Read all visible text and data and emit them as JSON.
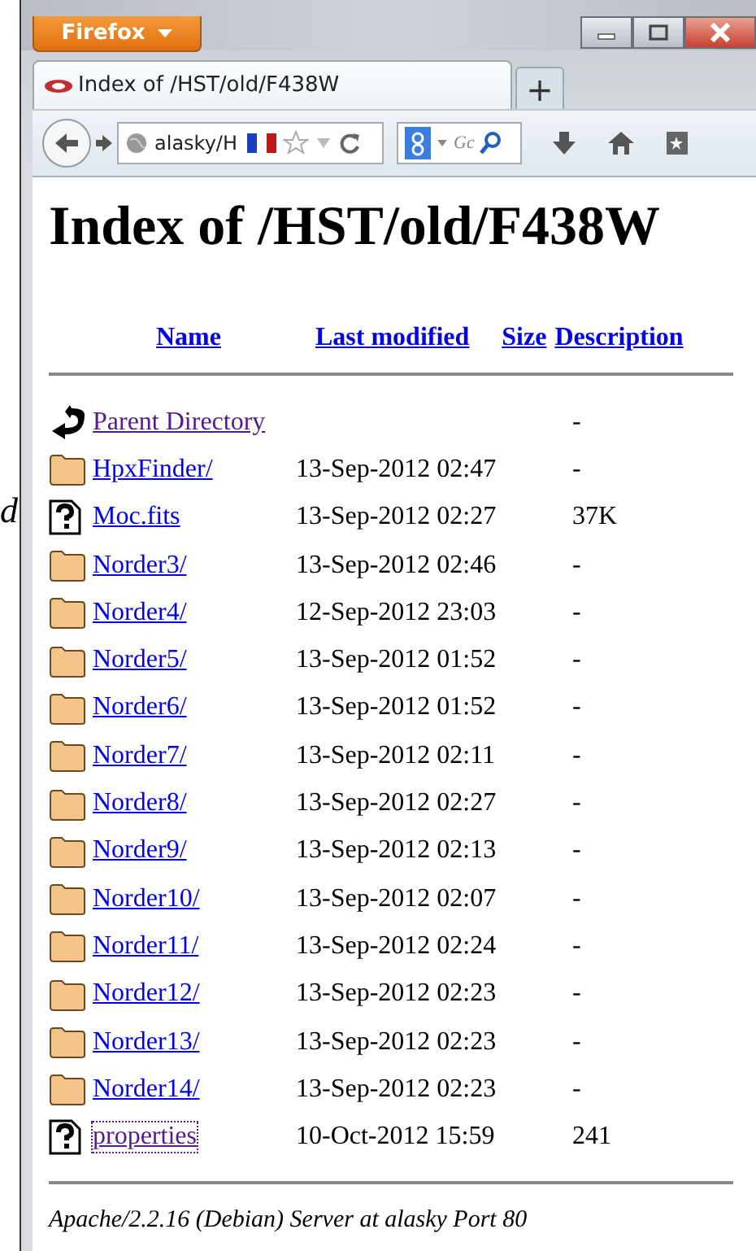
{
  "background_text": "d",
  "browser": {
    "menu_button": "Firefox",
    "tab": {
      "title": "Index of /HST/old/F438W",
      "selected": true
    },
    "new_tab": "+",
    "address": "alasky/H",
    "search_placeholder": "Gc"
  },
  "page": {
    "heading": "Index of /HST/old/F438W",
    "columns": [
      "Name",
      "Last modified",
      "Size",
      "Description"
    ],
    "rows": [
      {
        "kind": "parent",
        "name": "Parent Directory",
        "modified": "",
        "size": "-",
        "visited": true,
        "focused": false
      },
      {
        "kind": "folder",
        "name": "HpxFinder/",
        "modified": "13-Sep-2012 02:47",
        "size": "-",
        "visited": false,
        "focused": false
      },
      {
        "kind": "file",
        "name": "Moc.fits",
        "modified": "13-Sep-2012 02:27",
        "size": "37K",
        "visited": false,
        "focused": false
      },
      {
        "kind": "folder",
        "name": "Norder3/",
        "modified": "13-Sep-2012 02:46",
        "size": "-",
        "visited": false,
        "focused": false
      },
      {
        "kind": "folder",
        "name": "Norder4/",
        "modified": "12-Sep-2012 23:03",
        "size": "-",
        "visited": false,
        "focused": false
      },
      {
        "kind": "folder",
        "name": "Norder5/",
        "modified": "13-Sep-2012 01:52",
        "size": "-",
        "visited": false,
        "focused": false
      },
      {
        "kind": "folder",
        "name": "Norder6/",
        "modified": "13-Sep-2012 01:52",
        "size": "-",
        "visited": false,
        "focused": false
      },
      {
        "kind": "folder",
        "name": "Norder7/",
        "modified": "13-Sep-2012 02:11",
        "size": "-",
        "visited": false,
        "focused": false
      },
      {
        "kind": "folder",
        "name": "Norder8/",
        "modified": "13-Sep-2012 02:27",
        "size": "-",
        "visited": false,
        "focused": false
      },
      {
        "kind": "folder",
        "name": "Norder9/",
        "modified": "13-Sep-2012 02:13",
        "size": "-",
        "visited": false,
        "focused": false
      },
      {
        "kind": "folder",
        "name": "Norder10/",
        "modified": "13-Sep-2012 02:07",
        "size": "-",
        "visited": false,
        "focused": false
      },
      {
        "kind": "folder",
        "name": "Norder11/",
        "modified": "13-Sep-2012 02:24",
        "size": "-",
        "visited": false,
        "focused": false
      },
      {
        "kind": "folder",
        "name": "Norder12/",
        "modified": "13-Sep-2012 02:23",
        "size": "-",
        "visited": false,
        "focused": false
      },
      {
        "kind": "folder",
        "name": "Norder13/",
        "modified": "13-Sep-2012 02:23",
        "size": "-",
        "visited": false,
        "focused": false
      },
      {
        "kind": "folder",
        "name": "Norder14/",
        "modified": "13-Sep-2012 02:23",
        "size": "-",
        "visited": false,
        "focused": false
      },
      {
        "kind": "file",
        "name": "properties",
        "modified": "10-Oct-2012 15:59",
        "size": "241",
        "visited": true,
        "focused": true
      }
    ],
    "footer": "Apache/2.2.16 (Debian) Server at alasky Port 80"
  }
}
